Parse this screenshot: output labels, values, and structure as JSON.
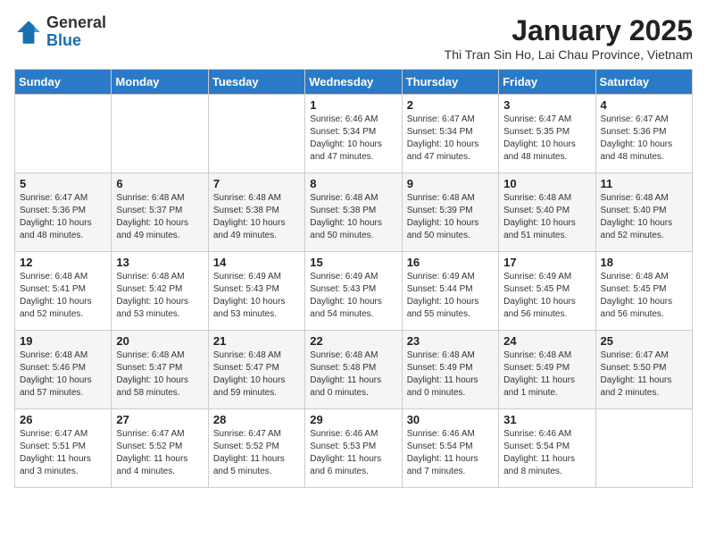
{
  "header": {
    "logo_general": "General",
    "logo_blue": "Blue",
    "title": "January 2025",
    "location": "Thi Tran Sin Ho, Lai Chau Province, Vietnam"
  },
  "days_of_week": [
    "Sunday",
    "Monday",
    "Tuesday",
    "Wednesday",
    "Thursday",
    "Friday",
    "Saturday"
  ],
  "weeks": [
    [
      {
        "day": "",
        "info": ""
      },
      {
        "day": "",
        "info": ""
      },
      {
        "day": "",
        "info": ""
      },
      {
        "day": "1",
        "info": "Sunrise: 6:46 AM\nSunset: 5:34 PM\nDaylight: 10 hours\nand 47 minutes."
      },
      {
        "day": "2",
        "info": "Sunrise: 6:47 AM\nSunset: 5:34 PM\nDaylight: 10 hours\nand 47 minutes."
      },
      {
        "day": "3",
        "info": "Sunrise: 6:47 AM\nSunset: 5:35 PM\nDaylight: 10 hours\nand 48 minutes."
      },
      {
        "day": "4",
        "info": "Sunrise: 6:47 AM\nSunset: 5:36 PM\nDaylight: 10 hours\nand 48 minutes."
      }
    ],
    [
      {
        "day": "5",
        "info": "Sunrise: 6:47 AM\nSunset: 5:36 PM\nDaylight: 10 hours\nand 48 minutes."
      },
      {
        "day": "6",
        "info": "Sunrise: 6:48 AM\nSunset: 5:37 PM\nDaylight: 10 hours\nand 49 minutes."
      },
      {
        "day": "7",
        "info": "Sunrise: 6:48 AM\nSunset: 5:38 PM\nDaylight: 10 hours\nand 49 minutes."
      },
      {
        "day": "8",
        "info": "Sunrise: 6:48 AM\nSunset: 5:38 PM\nDaylight: 10 hours\nand 50 minutes."
      },
      {
        "day": "9",
        "info": "Sunrise: 6:48 AM\nSunset: 5:39 PM\nDaylight: 10 hours\nand 50 minutes."
      },
      {
        "day": "10",
        "info": "Sunrise: 6:48 AM\nSunset: 5:40 PM\nDaylight: 10 hours\nand 51 minutes."
      },
      {
        "day": "11",
        "info": "Sunrise: 6:48 AM\nSunset: 5:40 PM\nDaylight: 10 hours\nand 52 minutes."
      }
    ],
    [
      {
        "day": "12",
        "info": "Sunrise: 6:48 AM\nSunset: 5:41 PM\nDaylight: 10 hours\nand 52 minutes."
      },
      {
        "day": "13",
        "info": "Sunrise: 6:48 AM\nSunset: 5:42 PM\nDaylight: 10 hours\nand 53 minutes."
      },
      {
        "day": "14",
        "info": "Sunrise: 6:49 AM\nSunset: 5:43 PM\nDaylight: 10 hours\nand 53 minutes."
      },
      {
        "day": "15",
        "info": "Sunrise: 6:49 AM\nSunset: 5:43 PM\nDaylight: 10 hours\nand 54 minutes."
      },
      {
        "day": "16",
        "info": "Sunrise: 6:49 AM\nSunset: 5:44 PM\nDaylight: 10 hours\nand 55 minutes."
      },
      {
        "day": "17",
        "info": "Sunrise: 6:49 AM\nSunset: 5:45 PM\nDaylight: 10 hours\nand 56 minutes."
      },
      {
        "day": "18",
        "info": "Sunrise: 6:48 AM\nSunset: 5:45 PM\nDaylight: 10 hours\nand 56 minutes."
      }
    ],
    [
      {
        "day": "19",
        "info": "Sunrise: 6:48 AM\nSunset: 5:46 PM\nDaylight: 10 hours\nand 57 minutes."
      },
      {
        "day": "20",
        "info": "Sunrise: 6:48 AM\nSunset: 5:47 PM\nDaylight: 10 hours\nand 58 minutes."
      },
      {
        "day": "21",
        "info": "Sunrise: 6:48 AM\nSunset: 5:47 PM\nDaylight: 10 hours\nand 59 minutes."
      },
      {
        "day": "22",
        "info": "Sunrise: 6:48 AM\nSunset: 5:48 PM\nDaylight: 11 hours\nand 0 minutes."
      },
      {
        "day": "23",
        "info": "Sunrise: 6:48 AM\nSunset: 5:49 PM\nDaylight: 11 hours\nand 0 minutes."
      },
      {
        "day": "24",
        "info": "Sunrise: 6:48 AM\nSunset: 5:49 PM\nDaylight: 11 hours\nand 1 minute."
      },
      {
        "day": "25",
        "info": "Sunrise: 6:47 AM\nSunset: 5:50 PM\nDaylight: 11 hours\nand 2 minutes."
      }
    ],
    [
      {
        "day": "26",
        "info": "Sunrise: 6:47 AM\nSunset: 5:51 PM\nDaylight: 11 hours\nand 3 minutes."
      },
      {
        "day": "27",
        "info": "Sunrise: 6:47 AM\nSunset: 5:52 PM\nDaylight: 11 hours\nand 4 minutes."
      },
      {
        "day": "28",
        "info": "Sunrise: 6:47 AM\nSunset: 5:52 PM\nDaylight: 11 hours\nand 5 minutes."
      },
      {
        "day": "29",
        "info": "Sunrise: 6:46 AM\nSunset: 5:53 PM\nDaylight: 11 hours\nand 6 minutes."
      },
      {
        "day": "30",
        "info": "Sunrise: 6:46 AM\nSunset: 5:54 PM\nDaylight: 11 hours\nand 7 minutes."
      },
      {
        "day": "31",
        "info": "Sunrise: 6:46 AM\nSunset: 5:54 PM\nDaylight: 11 hours\nand 8 minutes."
      },
      {
        "day": "",
        "info": ""
      }
    ]
  ]
}
